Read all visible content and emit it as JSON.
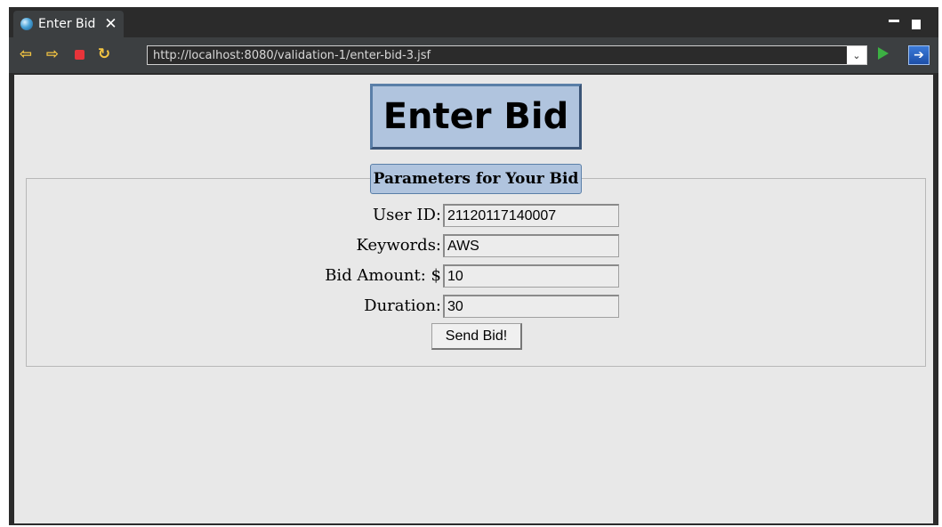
{
  "tab": {
    "title": "Enter Bid",
    "close": "✕"
  },
  "toolbar": {
    "back_icon": "back-arrow-icon",
    "forward_icon": "forward-arrow-icon",
    "stop_icon": "stop-icon",
    "refresh_icon": "refresh-icon",
    "back_glyph": "⇦",
    "forward_glyph": "⇨",
    "refresh_glyph": "↻",
    "url": "http://localhost:8080/validation-1/enter-bid-3.jsf",
    "dropdown_glyph": "⌄",
    "ext_glyph": "➔"
  },
  "page": {
    "heading": "Enter Bid",
    "legend": "Parameters for Your Bid",
    "fields": [
      {
        "label": "User ID:",
        "value": "21120117140007"
      },
      {
        "label": "Keywords:",
        "value": "AWS"
      },
      {
        "label": "Bid Amount: $",
        "value": "10"
      },
      {
        "label": "Duration:",
        "value": "30"
      }
    ],
    "submit": "Send Bid!"
  },
  "colors": {
    "heading_bg": "#b0c4de",
    "content_bg": "#e8e8e8",
    "chrome_bg": "#3c3f41"
  }
}
